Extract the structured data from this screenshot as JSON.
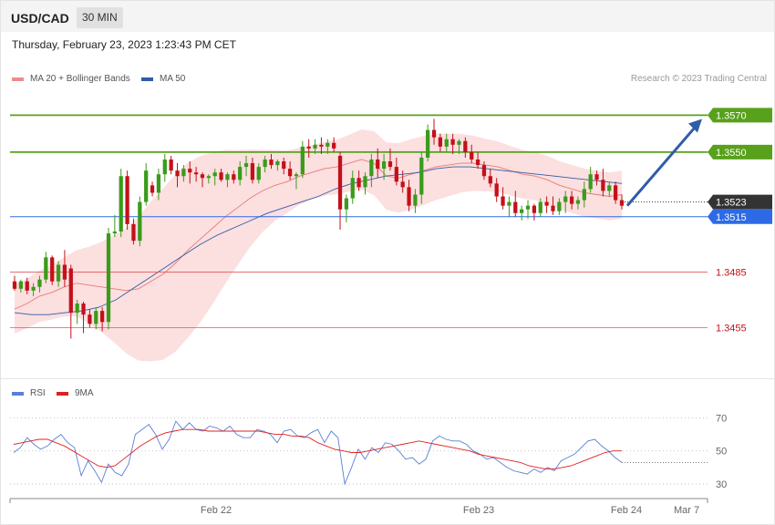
{
  "header": {
    "symbol": "USD/CAD",
    "timeframe": "30 MIN"
  },
  "timestamp": "Thursday, February 23, 2023 1:23:43 PM CET",
  "legend": {
    "ma20": "MA 20 + Bollinger Bands",
    "ma50": "MA 50"
  },
  "credit": "Research © 2023 Trading Central",
  "rsi_legend": {
    "rsi": "RSI",
    "ma": "9MA"
  },
  "colors": {
    "up": "#3a9b1c",
    "down": "#c4101a",
    "ma20": "#e87a7a",
    "ma50": "#2e5da8",
    "band": "#fbd9d9",
    "resistance": "#58a11a",
    "support": "#2d6be6",
    "current": "#333333",
    "lower": "#e05a5a",
    "arrow": "#2e5da8",
    "rsi": "#5a7fd6",
    "rsi_ma": "#e02020"
  },
  "chart_data": [
    {
      "type": "candlestick",
      "title": "USD/CAD 30 MIN",
      "ylim": [
        1.343,
        1.3585
      ],
      "x_labels": [
        "Feb 22",
        "Feb 23",
        "Feb 24",
        "Mar 7"
      ],
      "candles": [
        [
          1.348,
          1.3483,
          1.3475,
          1.3476
        ],
        [
          1.3476,
          1.3481,
          1.3474,
          1.348
        ],
        [
          1.348,
          1.3482,
          1.3473,
          1.3475
        ],
        [
          1.3475,
          1.3479,
          1.3472,
          1.3477
        ],
        [
          1.3477,
          1.3483,
          1.3474,
          1.3481
        ],
        [
          1.3481,
          1.3496,
          1.3479,
          1.3493
        ],
        [
          1.3493,
          1.3494,
          1.3478,
          1.348
        ],
        [
          1.348,
          1.3491,
          1.3477,
          1.3489
        ],
        [
          1.3489,
          1.3497,
          1.3477,
          1.3481
        ],
        [
          1.3487,
          1.3489,
          1.3449,
          1.3463
        ],
        [
          1.3463,
          1.347,
          1.3457,
          1.3468
        ],
        [
          1.3468,
          1.3469,
          1.3452,
          1.3462
        ],
        [
          1.3462,
          1.3465,
          1.3455,
          1.3457
        ],
        [
          1.3457,
          1.3466,
          1.3454,
          1.3464
        ],
        [
          1.3464,
          1.3466,
          1.3453,
          1.3458
        ],
        [
          1.3458,
          1.3509,
          1.3454,
          1.3506
        ],
        [
          1.3506,
          1.3516,
          1.3504,
          1.3507
        ],
        [
          1.3507,
          1.3541,
          1.3504,
          1.3537
        ],
        [
          1.3537,
          1.354,
          1.3508,
          1.3511
        ],
        [
          1.3511,
          1.3514,
          1.35,
          1.3502
        ],
        [
          1.3502,
          1.3526,
          1.3499,
          1.3523
        ],
        [
          1.3523,
          1.3544,
          1.3521,
          1.354
        ],
        [
          1.3532,
          1.3534,
          1.3526,
          1.3528
        ],
        [
          1.3528,
          1.3541,
          1.3524,
          1.3538
        ],
        [
          1.3538,
          1.3549,
          1.3534,
          1.3546
        ],
        [
          1.3546,
          1.3548,
          1.3538,
          1.354
        ],
        [
          1.354,
          1.3544,
          1.3531,
          1.3537
        ],
        [
          1.3537,
          1.3543,
          1.3534,
          1.3541
        ],
        [
          1.3541,
          1.3545,
          1.3533,
          1.3539
        ],
        [
          1.3539,
          1.3542,
          1.3534,
          1.3538
        ],
        [
          1.3538,
          1.3539,
          1.3531,
          1.3536
        ],
        [
          1.3536,
          1.3538,
          1.3533,
          1.3537
        ],
        [
          1.3537,
          1.3541,
          1.3532,
          1.3539
        ],
        [
          1.3539,
          1.3541,
          1.3534,
          1.3535
        ],
        [
          1.3535,
          1.3539,
          1.3531,
          1.3538
        ],
        [
          1.3538,
          1.354,
          1.3533,
          1.3535
        ],
        [
          1.3535,
          1.3545,
          1.3532,
          1.3542
        ],
        [
          1.3542,
          1.3548,
          1.3537,
          1.3544
        ],
        [
          1.3544,
          1.3547,
          1.3533,
          1.3535
        ],
        [
          1.3535,
          1.3544,
          1.3533,
          1.3542
        ],
        [
          1.3542,
          1.3548,
          1.3539,
          1.3546
        ],
        [
          1.3546,
          1.3549,
          1.3541,
          1.3543
        ],
        [
          1.3543,
          1.3546,
          1.354,
          1.3545
        ],
        [
          1.3545,
          1.3547,
          1.3538,
          1.3541
        ],
        [
          1.3541,
          1.3545,
          1.3535,
          1.3537
        ],
        [
          1.3537,
          1.3539,
          1.353,
          1.3538
        ],
        [
          1.3538,
          1.3556,
          1.3536,
          1.3553
        ],
        [
          1.3553,
          1.3557,
          1.3547,
          1.3552
        ],
        [
          1.3552,
          1.3557,
          1.3549,
          1.3554
        ],
        [
          1.3554,
          1.3558,
          1.3549,
          1.3553
        ],
        [
          1.3553,
          1.3557,
          1.3549,
          1.3555
        ],
        [
          1.3555,
          1.3558,
          1.355,
          1.3552
        ],
        [
          1.3548,
          1.355,
          1.3508,
          1.3519
        ],
        [
          1.3519,
          1.3527,
          1.3512,
          1.3525
        ],
        [
          1.3525,
          1.354,
          1.3522,
          1.3536
        ],
        [
          1.3536,
          1.354,
          1.3529,
          1.3531
        ],
        [
          1.3531,
          1.3539,
          1.3527,
          1.3537
        ],
        [
          1.3537,
          1.3549,
          1.3531,
          1.3546
        ],
        [
          1.3546,
          1.3552,
          1.3536,
          1.3541
        ],
        [
          1.3541,
          1.3549,
          1.3535,
          1.3545
        ],
        [
          1.3545,
          1.3552,
          1.354,
          1.3542
        ],
        [
          1.3542,
          1.3547,
          1.3532,
          1.3534
        ],
        [
          1.3534,
          1.354,
          1.3528,
          1.3531
        ],
        [
          1.3531,
          1.3535,
          1.3518,
          1.3521
        ],
        [
          1.3521,
          1.353,
          1.3517,
          1.3527
        ],
        [
          1.3527,
          1.355,
          1.3522,
          1.3547
        ],
        [
          1.3547,
          1.3565,
          1.3545,
          1.3562
        ],
        [
          1.3562,
          1.3568,
          1.3554,
          1.3558
        ],
        [
          1.3558,
          1.356,
          1.355,
          1.3553
        ],
        [
          1.3553,
          1.356,
          1.355,
          1.3557
        ],
        [
          1.3557,
          1.356,
          1.3549,
          1.3554
        ],
        [
          1.3554,
          1.3557,
          1.3549,
          1.3556
        ],
        [
          1.3556,
          1.3558,
          1.3547,
          1.355
        ],
        [
          1.355,
          1.3554,
          1.3544,
          1.3546
        ],
        [
          1.3546,
          1.355,
          1.3541,
          1.3543
        ],
        [
          1.3543,
          1.3545,
          1.3535,
          1.3537
        ],
        [
          1.3537,
          1.3541,
          1.3531,
          1.3533
        ],
        [
          1.3533,
          1.3536,
          1.3523,
          1.3526
        ],
        [
          1.3526,
          1.3531,
          1.3519,
          1.3521
        ],
        [
          1.3521,
          1.3526,
          1.3515,
          1.3523
        ],
        [
          1.3523,
          1.3529,
          1.3515,
          1.3517
        ],
        [
          1.3517,
          1.3521,
          1.3513,
          1.3519
        ],
        [
          1.3519,
          1.3524,
          1.3514,
          1.3521
        ],
        [
          1.3521,
          1.3522,
          1.3513,
          1.3517
        ],
        [
          1.3517,
          1.3525,
          1.3515,
          1.3523
        ],
        [
          1.3523,
          1.3526,
          1.3517,
          1.3521
        ],
        [
          1.3521,
          1.3526,
          1.3516,
          1.3518
        ],
        [
          1.3518,
          1.3525,
          1.3516,
          1.3523
        ],
        [
          1.3523,
          1.3529,
          1.3517,
          1.3526
        ],
        [
          1.3526,
          1.3529,
          1.3519,
          1.3522
        ],
        [
          1.3522,
          1.3526,
          1.3519,
          1.3524
        ],
        [
          1.3524,
          1.3534,
          1.352,
          1.353
        ],
        [
          1.353,
          1.3542,
          1.3528,
          1.3538
        ],
        [
          1.3538,
          1.354,
          1.3532,
          1.3535
        ],
        [
          1.3535,
          1.3541,
          1.3526,
          1.3529
        ],
        [
          1.3529,
          1.3534,
          1.3526,
          1.3532
        ],
        [
          1.3532,
          1.3534,
          1.3522,
          1.3524
        ],
        [
          1.3524,
          1.3527,
          1.3519,
          1.3521
        ]
      ],
      "ma20": [
        [
          1.3465,
          1.3468,
          1.3472,
          1.3474,
          1.3477,
          1.3479,
          1.3478,
          1.3477,
          1.3476,
          1.3475,
          1.3476,
          1.348,
          1.3484,
          1.349,
          1.3497,
          1.3503,
          1.3509,
          1.3515,
          1.352,
          1.3525,
          1.3529,
          1.3532,
          1.3534,
          1.3537,
          1.3539,
          1.3541,
          1.3542,
          1.3544,
          1.3546,
          1.3544,
          1.3537,
          1.3536,
          1.3538,
          1.354,
          1.3542,
          1.3543,
          1.3544,
          1.3544,
          1.3543,
          1.3542,
          1.354,
          1.3538,
          1.3537,
          1.3535,
          1.3532,
          1.353,
          1.3528,
          1.3527,
          1.3526,
          1.3527
        ]
      ],
      "ma50": [
        1.3463,
        1.3462,
        1.3462,
        1.3463,
        1.3464,
        1.3466,
        1.347,
        1.3476,
        1.3482,
        1.3488,
        1.3494,
        1.35,
        1.3505,
        1.3509,
        1.3513,
        1.3517,
        1.352,
        1.3523,
        1.3526,
        1.353,
        1.3533,
        1.3535,
        1.3537,
        1.3538,
        1.3539,
        1.3541,
        1.3542,
        1.3542,
        1.3541,
        1.354,
        1.3539,
        1.3538,
        1.3537,
        1.3536,
        1.3535,
        1.3534,
        1.3533
      ],
      "levels": [
        {
          "value": "1.3570",
          "kind": "resistance"
        },
        {
          "value": "1.3550",
          "kind": "resistance"
        },
        {
          "value": "1.3523",
          "kind": "current"
        },
        {
          "value": "1.3515",
          "kind": "support"
        },
        {
          "value": "1.3485",
          "kind": "support2"
        },
        {
          "value": "1.3455",
          "kind": "support3"
        }
      ],
      "arrow": {
        "from": 1.3521,
        "to": 1.3568
      }
    },
    {
      "type": "line",
      "title": "RSI",
      "ylim": [
        25,
        78
      ],
      "y_ticks": [
        70,
        50,
        30
      ],
      "series": [
        {
          "name": "RSI",
          "values": [
            49,
            52,
            58,
            54,
            51,
            53,
            57,
            60,
            55,
            52,
            35,
            44,
            38,
            31,
            42,
            37,
            35,
            42,
            60,
            63,
            66,
            60,
            51,
            57,
            68,
            63,
            67,
            63,
            62,
            65,
            64,
            62,
            65,
            60,
            58,
            58,
            63,
            62,
            60,
            55,
            62,
            63,
            59,
            58,
            61,
            63,
            55,
            62,
            58,
            30,
            40,
            51,
            45,
            52,
            49,
            55,
            54,
            50,
            45,
            46,
            42,
            45,
            56,
            59,
            57,
            56,
            56,
            54,
            50,
            48,
            45,
            46,
            43,
            40,
            38,
            37,
            36,
            39,
            37,
            40,
            38,
            44,
            46,
            48,
            52,
            56,
            57,
            53,
            50,
            46,
            43
          ]
        },
        {
          "name": "9MA",
          "values": [
            54,
            55,
            56,
            57,
            57,
            55,
            53,
            50,
            47,
            44,
            41,
            40,
            41,
            45,
            49,
            53,
            56,
            59,
            61,
            62,
            63,
            63,
            63,
            62,
            62,
            62,
            62,
            62,
            62,
            62,
            61,
            60,
            60,
            59,
            59,
            58,
            55,
            53,
            51,
            50,
            49,
            49,
            50,
            51,
            52,
            53,
            54,
            55,
            56,
            55,
            54,
            53,
            52,
            51,
            50,
            48,
            47,
            46,
            45,
            44,
            43,
            41,
            40,
            39,
            39,
            40,
            41,
            43,
            45,
            47,
            49,
            50,
            50
          ]
        }
      ]
    }
  ]
}
